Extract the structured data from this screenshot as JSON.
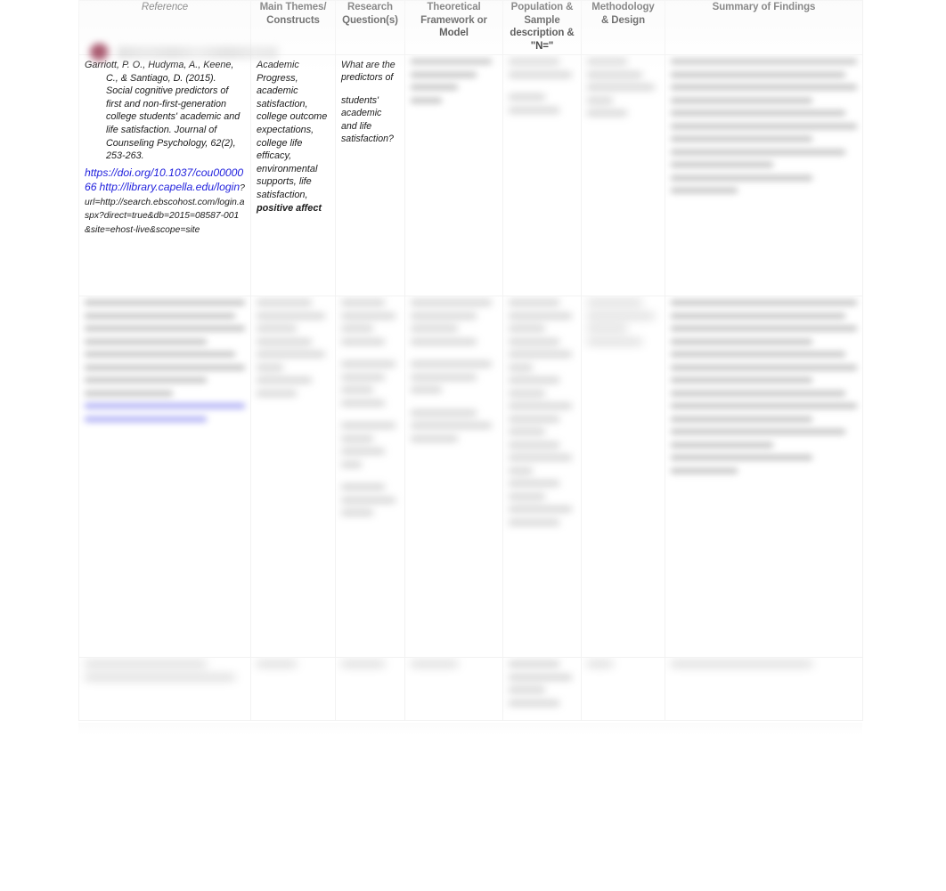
{
  "document": {
    "title": "Literature Review Matrix",
    "logo_smudge_color": "#8d2b44",
    "link_color": "#2222dd"
  },
  "table": {
    "headers": [
      {
        "id": "reference",
        "label": "Reference",
        "style": "italic"
      },
      {
        "id": "main-themes",
        "label": "Main Themes/\nConstructs",
        "style": "bold"
      },
      {
        "id": "research-question",
        "label": "Research\nQuestion(s)",
        "style": "bold"
      },
      {
        "id": "theoretical-framework",
        "label": "Theoretical\nFramework or\nModel",
        "style": "bold"
      },
      {
        "id": "population-sample",
        "label": "Population &\nSample\ndescription &\n\"N=\"",
        "style": "bold"
      },
      {
        "id": "methodology-design",
        "label": "Methodology\n& Design",
        "style": "bold"
      },
      {
        "id": "summary-findings",
        "label": "Summary of Findings",
        "style": "bold"
      }
    ],
    "rows": [
      {
        "id": "row-garriott-2015",
        "reference": {
          "citation_first_line": "Garriott, P. O., Hudyma, A., Keene,",
          "citation_rest": "C., & Santiago, D. (2015). Social cognitive predictors of first and non-first-generation college students' academic and life satisfaction. Journal of Counseling Psychology, 62(2), 253-263.",
          "doi_link": "https://doi.org/10.1037/cou0000066",
          "proxy_link": "http://library.capella.edu/login",
          "query_tail": "?url=http://search.ebscohost.com/login.aspx?direct=true&db=2015=08587-001 &site=ehost-live&scope=site"
        },
        "main_themes": {
          "plain": "Academic Progress, academic satisfaction, college outcome expectations, college life efficacy, environmental supports, life satisfaction, ",
          "bold": "positive affect"
        },
        "research_question": {
          "line1": "What are the predictors of",
          "line2": "students' academic and life satisfaction?"
        },
        "theoretical_framework": {
          "redacted": true
        },
        "population_sample": {
          "redacted": true
        },
        "methodology_design": {
          "redacted": true
        },
        "summary_findings": {
          "redacted": true
        }
      },
      {
        "id": "row-2",
        "reference": {
          "redacted": true
        },
        "main_themes": {
          "redacted": true
        },
        "research_question": {
          "redacted": true
        },
        "theoretical_framework": {
          "redacted": true
        },
        "population_sample": {
          "redacted": true
        },
        "methodology_design": {
          "redacted": true
        },
        "summary_findings": {
          "redacted": true
        }
      },
      {
        "id": "row-3",
        "reference": {
          "redacted": true
        },
        "main_themes": {
          "redacted": true
        },
        "research_question": {
          "redacted": true
        },
        "theoretical_framework": {
          "redacted": true
        },
        "population_sample": {
          "redacted": true
        },
        "methodology_design": {
          "redacted": true
        },
        "summary_findings": {
          "redacted": true
        }
      }
    ]
  }
}
